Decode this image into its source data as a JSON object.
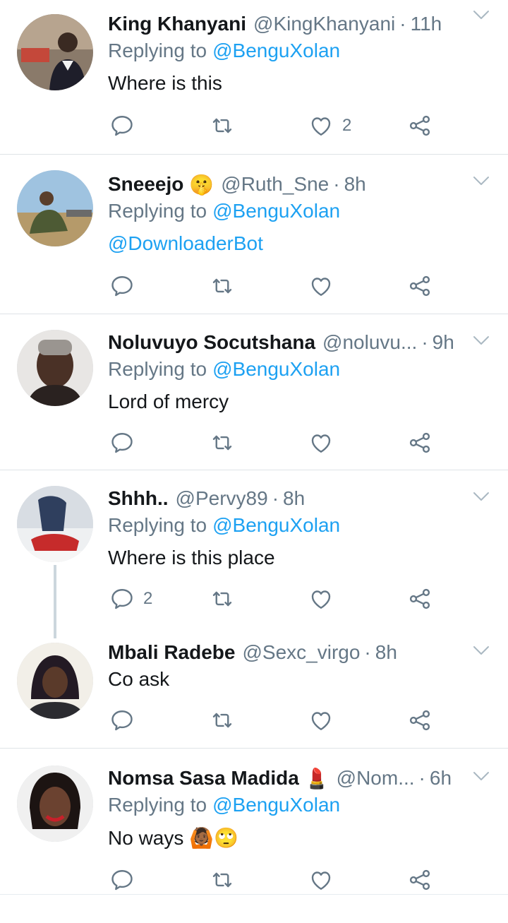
{
  "tweets": [
    {
      "name": "King Khanyani",
      "emoji": "",
      "handle": "@KingKhanyani",
      "time": "11h",
      "replying_label": "Replying to",
      "replying_to": "@BenguXolan",
      "text": "Where is this",
      "text_is_link": false,
      "reply_count": "",
      "like_count": "2"
    },
    {
      "name": "Sneeejo",
      "emoji": "🤫",
      "handle": "@Ruth_Sne",
      "time": "8h",
      "replying_label": "Replying to",
      "replying_to": "@BenguXolan",
      "text": "@DownloaderBot",
      "text_is_link": true,
      "reply_count": "",
      "like_count": ""
    },
    {
      "name": "Noluvuyo Socutshana",
      "emoji": "",
      "handle": "@noluvu...",
      "time": "9h",
      "replying_label": "Replying to",
      "replying_to": "@BenguXolan",
      "text": "Lord of mercy",
      "text_is_link": false,
      "reply_count": "",
      "like_count": ""
    },
    {
      "name": "Shhh..",
      "emoji": "",
      "handle": "@Pervy89",
      "time": "8h",
      "replying_label": "Replying to",
      "replying_to": "@BenguXolan",
      "text": "Where is this place",
      "text_is_link": false,
      "reply_count": "2",
      "like_count": ""
    },
    {
      "name": "Mbali Radebe",
      "emoji": "",
      "handle": "@Sexc_virgo",
      "time": "8h",
      "replying_label": "",
      "replying_to": "",
      "text": "Co ask",
      "text_is_link": false,
      "reply_count": "",
      "like_count": ""
    },
    {
      "name": "Nomsa Sasa Madida",
      "emoji": "💄",
      "handle": "@Nom...",
      "time": "6h",
      "replying_label": "Replying to",
      "replying_to": "@BenguXolan",
      "text": "No ways 🙆🏾🙄",
      "text_is_link": false,
      "reply_count": "",
      "like_count": ""
    }
  ],
  "icons": {
    "reply": "reply-icon",
    "retweet": "retweet-icon",
    "like": "heart-icon",
    "share": "share-icon",
    "menu": "chevron-down-icon"
  },
  "colors": {
    "link": "#1da1f2",
    "secondary": "#657786",
    "text": "#14171a",
    "divider": "#dfe3e7"
  }
}
